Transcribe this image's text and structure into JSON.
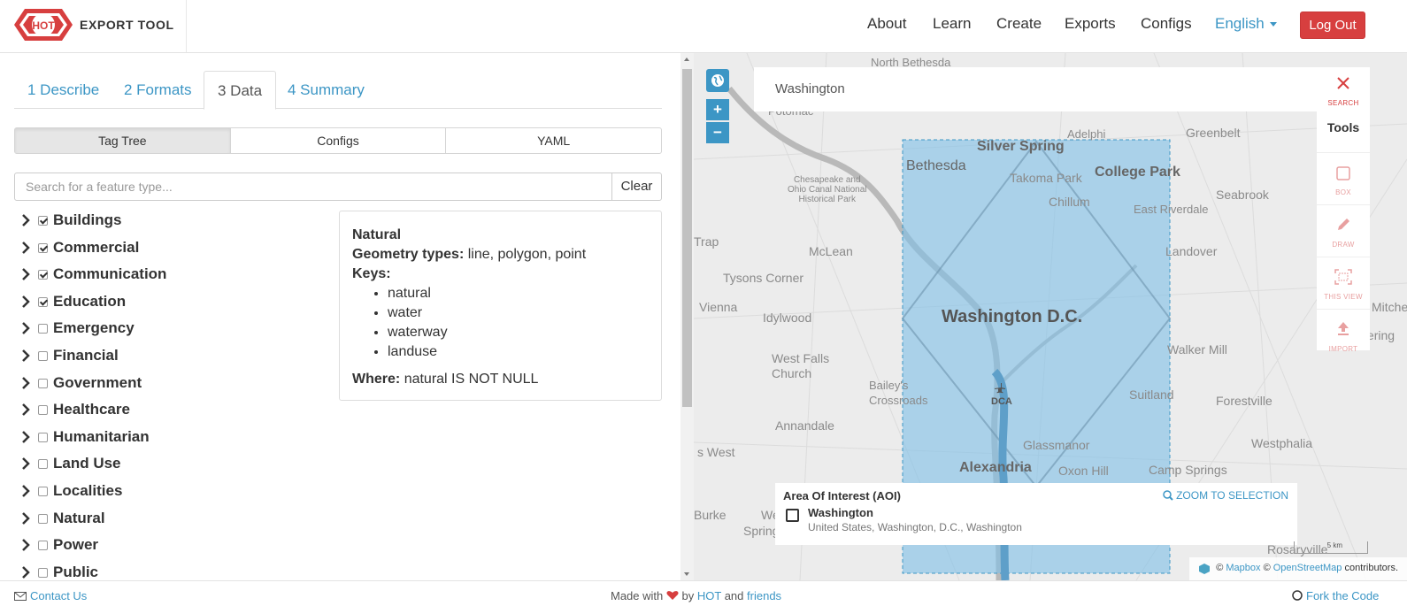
{
  "header": {
    "brand_badge": "HOT",
    "brand": "EXPORT TOOL",
    "nav": [
      "About",
      "Learn",
      "Create",
      "Exports",
      "Configs"
    ],
    "language": "English",
    "logout": "Log Out",
    "colors": {
      "accent": "#3c96c5",
      "danger": "#d73f3f",
      "brand_red": "#d73f3f"
    }
  },
  "wizard": {
    "tabs": [
      "1 Describe",
      "2 Formats",
      "3 Data",
      "4 Summary"
    ],
    "active_tab": "3 Data"
  },
  "data_mode": {
    "options": [
      "Tag Tree",
      "Configs",
      "YAML"
    ],
    "selected": "Tag Tree"
  },
  "feature_search": {
    "placeholder": "Search for a feature type...",
    "value": "",
    "clear": "Clear"
  },
  "tag_tree": [
    {
      "label": "Buildings",
      "checked": true
    },
    {
      "label": "Commercial",
      "checked": true
    },
    {
      "label": "Communication",
      "checked": true
    },
    {
      "label": "Education",
      "checked": true
    },
    {
      "label": "Emergency",
      "checked": false
    },
    {
      "label": "Financial",
      "checked": false
    },
    {
      "label": "Government",
      "checked": false
    },
    {
      "label": "Healthcare",
      "checked": false
    },
    {
      "label": "Humanitarian",
      "checked": false
    },
    {
      "label": "Land Use",
      "checked": false
    },
    {
      "label": "Localities",
      "checked": false
    },
    {
      "label": "Natural",
      "checked": false
    },
    {
      "label": "Power",
      "checked": false
    },
    {
      "label": "Public",
      "checked": false
    }
  ],
  "feature_info": {
    "name": "Natural",
    "geometry_label": "Geometry types:",
    "geometry_value": "line, polygon, point",
    "keys_label": "Keys:",
    "keys": [
      "natural",
      "water",
      "waterway",
      "landuse"
    ],
    "where_label": "Where:",
    "where_value": "natural IS NOT NULL"
  },
  "map": {
    "search_value": "Washington",
    "zoom_in": "+",
    "zoom_out": "−",
    "tools": {
      "search": "SEARCH",
      "title": "Tools",
      "box": "BOX",
      "draw": "DRAW",
      "this_view": "THIS VIEW",
      "import": "IMPORT"
    },
    "places": {
      "north_bethesda": "North Bethesda",
      "potomac": "Potomac",
      "adelphi": "Adelphi",
      "greenbelt": "Greenbelt",
      "silver_spring": "Silver Spring",
      "bethesda": "Bethesda",
      "college_park": "College Park",
      "takoma_park": "Takoma Park",
      "chillum": "Chillum",
      "seabrook": "Seabrook",
      "east_riverdale": "East Riverdale",
      "canal_park_1": "Chesapeake and",
      "canal_park_2": "Ohio Canal National",
      "canal_park_3": "Historical Park",
      "trap": "Trap",
      "mclean": "McLean",
      "landover": "Landover",
      "tysons_corner": "Tysons Corner",
      "vienna": "Vienna",
      "idylwood": "Idylwood",
      "washington_dc": "Washington D.C.",
      "mitche": "Mitche",
      "kettering": "Kettering",
      "west_falls_1": "West Falls",
      "west_falls_2": "Church",
      "walker_mill": "Walker Mill",
      "baileys_1": "Bailey's",
      "baileys_2": "Crossroads",
      "dca": "DCA",
      "suitland": "Suitland",
      "forestville": "Forestville",
      "annandale": "Annandale",
      "westphalia": "Westphalia",
      "s_west": "s West",
      "glassmanor": "Glassmanor",
      "alexandria": "Alexandria",
      "oxon_hill": "Oxon Hill",
      "camp_springs": "Camp Springs",
      "burke": "Burke",
      "we": "We",
      "spring": "Spring",
      "rosaryville": "Rosaryville"
    },
    "scale_label": "5 km",
    "attribution": {
      "prefix": "©",
      "mapbox": "Mapbox",
      "sep": "©",
      "osm": "OpenStreetMap",
      "suffix": "contributors."
    },
    "aoi": {
      "title": "Area Of Interest (AOI)",
      "zoom": "ZOOM TO SELECTION",
      "name": "Washington",
      "address": "United States, Washington, D.C., Washington"
    },
    "colors": {
      "selection": "#7fbfe8",
      "selection_border": "#3c96c5"
    }
  },
  "footer": {
    "contact": "Contact Us",
    "made_with": "Made with",
    "by": "by",
    "hot": "HOT",
    "and": "and",
    "friends": "friends",
    "fork": "Fork the Code"
  }
}
